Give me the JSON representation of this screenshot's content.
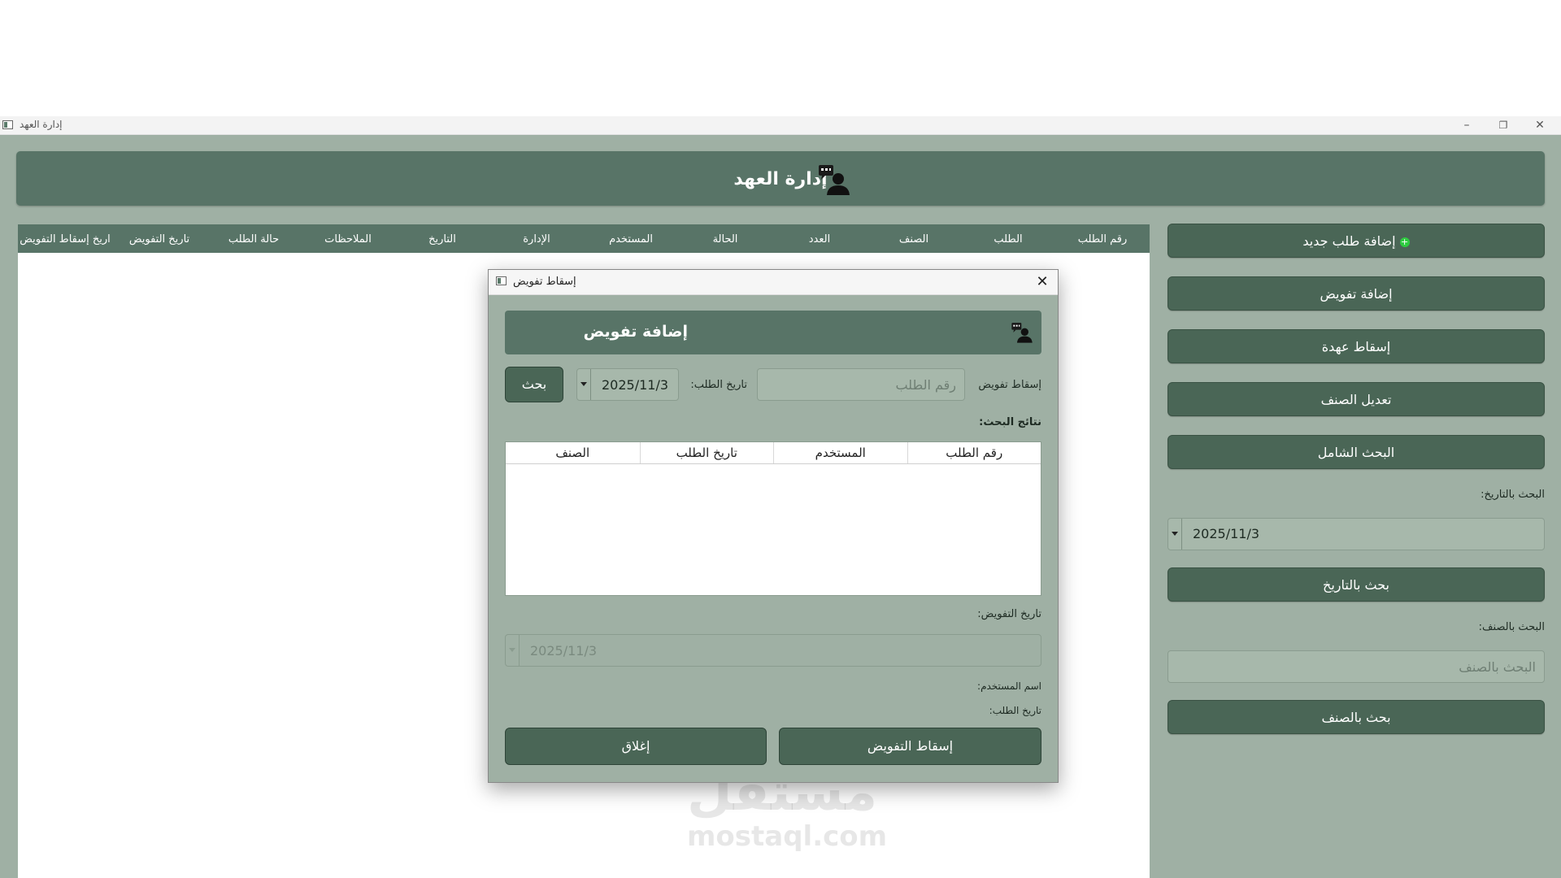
{
  "window": {
    "title": "إدارة العهد",
    "controls": {
      "minimize": "–",
      "restore": "❐",
      "close": "✕"
    }
  },
  "header": {
    "title": "إدارة العهد",
    "icon": "chat-user-icon"
  },
  "table": {
    "columns": [
      "رقم الطلب",
      "الطلب",
      "الصنف",
      "العدد",
      "الحالة",
      "المستخدم",
      "الإدارة",
      "التاريخ",
      "الملاحظات",
      "حالة الطلب",
      "تاريخ التفويض",
      "اريخ إسقاط التفويض"
    ],
    "rows": []
  },
  "sidebar": {
    "add_request_label": "إضافة طلب جديد",
    "add_request_icon": "plus-icon",
    "add_delegation_label": "إضافة تفويض",
    "drop_custody_label": "إسقاط عهدة",
    "edit_category_label": "تعديل الصنف",
    "full_search_label": "البحث الشامل",
    "search_by_date_label": "البحث بالتاريخ:",
    "date_value": "2025/11/3",
    "search_date_button": "بحث بالتاريخ",
    "search_by_category_label": "البحث بالصنف:",
    "category_placeholder": "البحث بالصنف",
    "search_category_button": "بحث بالصنف"
  },
  "dialog": {
    "title": "إسقاط تفويض",
    "header_title": "إضافة تفويض",
    "header_icon": "chat-user-icon",
    "drop_label": "إسقاط تفويض",
    "request_number_placeholder": "رقم الطلب",
    "request_date_label": "تاريخ الطلب:",
    "request_date_value": "2025/11/3",
    "search_button": "بحث",
    "results_label": "نتائج البحث:",
    "results_columns": [
      "رقم الطلب",
      "المستخدم",
      "تاريخ الطلب",
      "الصنف"
    ],
    "delegation_date_label": "تاريخ  التفويض:",
    "delegation_date_value": "2025/11/3",
    "username_label": "اسم المستخدم:",
    "request_date_info_label": "تاريخ الطلب:",
    "drop_delegation_button": "إسقاط التفويض",
    "close_button": "إغلاق"
  },
  "watermark": {
    "arabic": "مستقل",
    "latin": "mostaql.com"
  },
  "colors": {
    "primary": "#587467",
    "button": "#4a6656",
    "background": "#9fb0a4",
    "accent_plus": "#2ecc40"
  }
}
